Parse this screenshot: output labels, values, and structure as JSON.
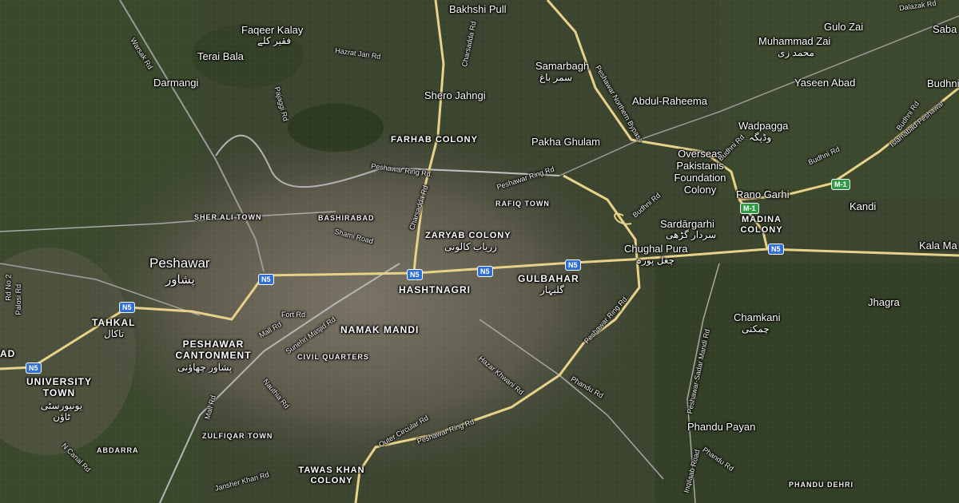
{
  "colors": {
    "highway": "#e8d28a",
    "major_road": "#c9c9c9",
    "rail": "#9a9a9a",
    "shield_blue": "#2f6fd6",
    "shield_green": "#2f9d45"
  },
  "places": {
    "bakhshi_pull": "Bakhshi Pull",
    "faqeer_kalay": "Faqeer Kalay",
    "faqeer_kalay_urdu": "فقیر کلے",
    "terai_bala": "Terai Bala",
    "darmangi": "Darmangi",
    "shero_jahngi": "Shero Jahngi",
    "samarbagh": "Samarbagh",
    "samarbagh_urdu": "سمر باغ",
    "abdul_raheema": "Abdul-Raheema",
    "gulo_zai": "Gulo Zai",
    "muhammad_zai": "Muhammad Zai",
    "muhammad_zai_urdu": "محمد زی",
    "yaseen_abad": "Yaseen Abad",
    "budhni": "Budhni",
    "saba": "Saba",
    "wadpagga": "Wadpagga",
    "wadpagga_urdu": "وڈپگہ",
    "farhab_colony": "FARHAB COLONY",
    "pakha_ghulam": "Pakha Ghulam",
    "overseas_foundation": "Overseas Pakistanis Foundation Colony",
    "rano_garhi": "Rano Garhi",
    "kandi": "Kandi",
    "rafiq_town": "RAFIQ TOWN",
    "sher_ali_town": "SHER ALI TOWN",
    "bashirabad": "BASHIRABAD",
    "zaryab_colony": "ZARYAB COLONY",
    "zaryab_colony_urdu": "زریاب کالونی",
    "sardargarhi": "Sardārgarhi",
    "sardargarhi_urdu": "سردار گڑھی",
    "madina_colony": "MADINA COLONY",
    "peshawar": "Peshawar",
    "peshawar_urdu": "پشاور",
    "chughal_pura": "Chughal Pura",
    "chughal_pura_urdu": "چغل پورہ",
    "kala_mandi": "Kala Ma",
    "hashtnagri": "HASHTNAGRI",
    "gulbahar": "GULBAHAR",
    "gulbahar_urdu": "گلبہار",
    "jhagra": "Jhagra",
    "tahkal": "TAHKAL",
    "tahkal_urdu": "تاکال",
    "namak_mandi": "NAMAK MANDI",
    "chamkani": "Chamkani",
    "chamkani_urdu": "چمکنی",
    "peshawar_cantonment": "PESHAWAR CANTONMENT",
    "peshawar_cantonment_urdu": "پشاور چھاؤنی",
    "civil_quarters": "CIVIL QUARTERS",
    "university_town": "UNIVERSITY TOWN",
    "university_town_urdu": "یونیورسٹی ٹاؤن",
    "ad": "AD",
    "phandu_payan": "Phandu Payan",
    "zulfiqar_town": "ZULFIQAR TOWN",
    "abdarra": "ABDARRA",
    "tawas_khan_colony": "TAWAS KHAN COLONY",
    "phandu_dehri": "PHANDU DEHRI"
  },
  "roads": {
    "warsak_rd": "Warsak Rd",
    "hazrat_jan_rd": "Hazrat Jan Rd",
    "pajaggi_rd": "Pajaggi Rd",
    "charsadda_rd_north": "Charsadda Rd",
    "charsadda_rd_south": "Charsadda Rd",
    "peshawar_northern_bypass": "Peshawar Northern Bypass",
    "dalazak_rd": "Dalazak Rd",
    "budhni_rd_ne": "Budhni Rd",
    "budhni_rd_e": "Budhni Rd",
    "budhni_rd_c": "Budhni Rd",
    "islamabad_peshawar": "Islamabad-Peshawar",
    "peshawar_ring_rd_w": "Peshawar Ring Rd.",
    "peshawar_ring_rd_c": "Peshawar Ring Rd",
    "shami_road": "Shami Road",
    "peshawar_ring_rd_se": "Peshawar Ring Rd.",
    "fort_rd": "Fort Rd",
    "mall_rd_n": "Mall Rd",
    "sunehri_masjid_rd": "Sunehri Masjid Rd",
    "hazar_khwani_rd": "Hazar Khwani Rd",
    "phandu_rd": "Phandu Rd",
    "peshawar_sadar_mandi_rd": "Peshawar-Sadar Mandi Rd",
    "nauthia_rd": "Nauthia Rd",
    "mall_rd_s": "Mall Rd",
    "outer_circular_rd": "Outer Circular Rd",
    "peshawar_ring_rd_s": "Peshawar Ring Rd.",
    "n_canal_rd": "N Canal Rd",
    "jamshed_khan_rd": "Jansher Khan Rd",
    "inqilaab_road": "Inqilaab Road",
    "phandu_rd_s": "Phandu Rd",
    "palosi_rd": "Palosi Rd",
    "rd_no_2": "Rd No 2"
  },
  "shields": {
    "n5": "N5",
    "m1": "M-1"
  }
}
